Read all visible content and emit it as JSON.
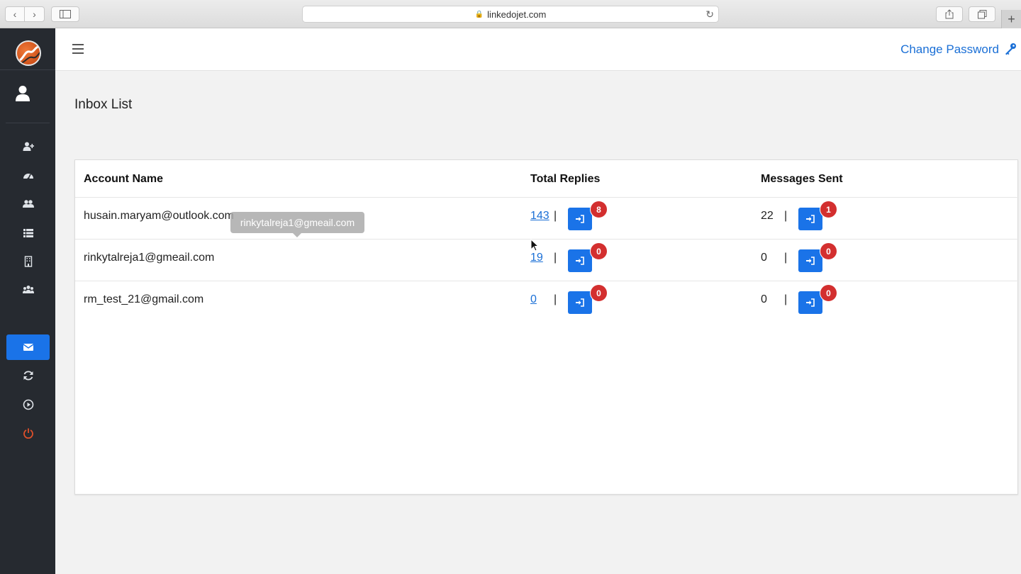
{
  "browser": {
    "url": "linkedojet.com",
    "lock_glyph": "🔒"
  },
  "header": {
    "change_password_label": "Change Password"
  },
  "page": {
    "title": "Inbox List"
  },
  "sidebar": {
    "active_item": "inbox",
    "items": [
      {
        "name": "add-user-icon"
      },
      {
        "name": "dashboard-icon"
      },
      {
        "name": "users-icon"
      },
      {
        "name": "list-icon"
      },
      {
        "name": "building-icon"
      },
      {
        "name": "group-icon"
      },
      {
        "name": "envelope-icon"
      },
      {
        "name": "refresh-icon"
      },
      {
        "name": "play-circle-icon"
      },
      {
        "name": "power-icon"
      }
    ]
  },
  "table": {
    "headers": {
      "account_name": "Account Name",
      "total_replies": "Total Replies",
      "messages_sent": "Messages Sent"
    },
    "separator": "|",
    "rows": [
      {
        "account": "husain.maryam@outlook.com",
        "replies": "143",
        "replies_badge": "8",
        "sent": "22",
        "sent_badge": "1"
      },
      {
        "account": "rinkytalreja1@gmeail.com",
        "replies": "19",
        "replies_badge": "0",
        "sent": "0",
        "sent_badge": "0"
      },
      {
        "account": "rm_test_21@gmail.com",
        "replies": "0",
        "replies_badge": "0",
        "sent": "0",
        "sent_badge": "0"
      }
    ]
  },
  "tooltip": {
    "text": "rinkytalreja1@gmeail.com"
  },
  "colors": {
    "sidebar_bg": "#262a30",
    "accent": "#1a73e8",
    "badge": "#d32f2f",
    "link": "#1a6fd6"
  }
}
